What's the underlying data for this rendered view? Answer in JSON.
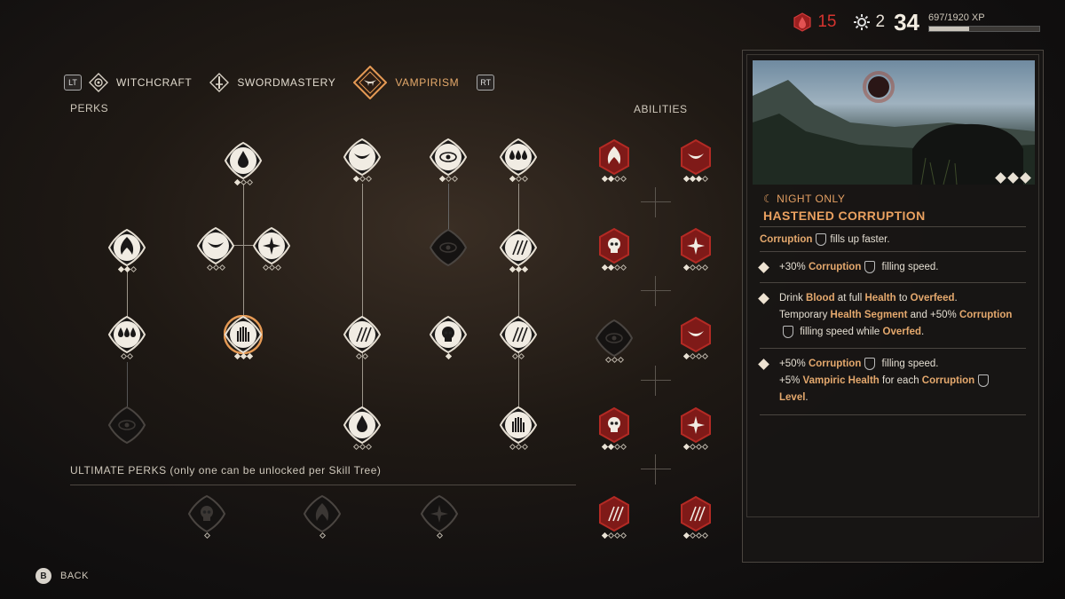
{
  "top_bar": {
    "blood_count": "15",
    "skill_points": "2",
    "level": "34",
    "xp_text": "697/1920 XP",
    "xp_progress": 0.363,
    "blood_color": "#c42a2a"
  },
  "tabs": {
    "left_trigger": "LT",
    "right_trigger": "RT",
    "items": [
      {
        "label": "WITCHCRAFT",
        "icon": "witchcraft-icon"
      },
      {
        "label": "SWORDMASTERY",
        "icon": "sword-icon"
      },
      {
        "label": "VAMPIRISM",
        "icon": "vampirism-icon",
        "active": true
      }
    ]
  },
  "sections": {
    "perks": "PERKS",
    "abilities": "ABILITIES",
    "ultimate": "ULTIMATE PERKS (only one can be unlocked per Skill Tree)"
  },
  "details": {
    "tag": "☾ NIGHT ONLY",
    "title": "HASTENED CORRUPTION",
    "summary_kw": "Corruption",
    "summary_rest": "fills up faster.",
    "levels": [
      {
        "parts": [
          "+30% ",
          "Corruption",
          "",
          " filling speed."
        ]
      },
      {
        "l1_a": "Drink ",
        "l1_b": "Blood",
        "l1_c": " at full ",
        "l1_d": "Health",
        "l1_e": " to ",
        "l1_f": "Overfeed",
        "l1_g": ".",
        "l2_a": "Temporary ",
        "l2_b": "Health Segment",
        "l2_c": " and +50% ",
        "l2_d": "Corruption",
        "l3_a": " filling speed while ",
        "l3_b": "Overfed",
        "l3_c": "."
      },
      {
        "l1_a": "+50% ",
        "l1_b": "Corruption",
        "l1_c": " filling speed.",
        "l2_a": "+5% ",
        "l2_b": "Vampiric Health",
        "l2_c": " for each ",
        "l2_d": "Corruption",
        "l3_a": "Level",
        "l3_b": "."
      }
    ],
    "level_pips": 3
  },
  "footer": {
    "button": "B",
    "label": "BACK"
  },
  "colors": {
    "accent": "#e5a96b",
    "ability_red": "#8e1c1c",
    "perk_white": "#e8e1d4"
  }
}
